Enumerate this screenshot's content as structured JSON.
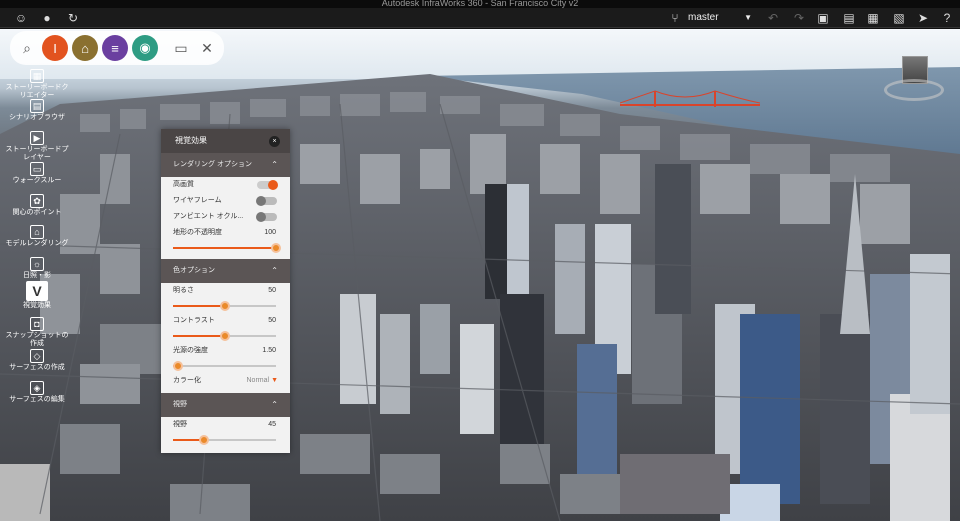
{
  "window": {
    "title": "Autodesk InfraWorks 360 - San Francisco City v2"
  },
  "topbar": {
    "branch": "master",
    "icons": [
      "user-icon",
      "record-icon",
      "sync-icon",
      "branch-icon",
      "undo-icon",
      "redo-icon",
      "bookmark-icon",
      "grid-icon",
      "image-icon",
      "select-cursor-icon",
      "help-icon"
    ]
  },
  "main_tools": [
    {
      "name": "build-tool",
      "color": "#e2531f",
      "glyph": "I"
    },
    {
      "name": "analyze-tool",
      "color": "#8a7030",
      "glyph": "⌂"
    },
    {
      "name": "bridge-tool",
      "color": "#6a3fa0",
      "glyph": "≡"
    },
    {
      "name": "share-tool",
      "color": "#2e9c83",
      "glyph": "◉"
    }
  ],
  "side_tools": [
    {
      "label": "ストーリーボードクリエイター"
    },
    {
      "label": "シナリオブラウザ"
    },
    {
      "label": "ストーリーボードプレイヤー"
    },
    {
      "label": "ウォークスルー"
    },
    {
      "label": "関心のポイント"
    },
    {
      "label": "モデルレンダリング"
    },
    {
      "label": "日照・影"
    },
    {
      "label": "視覚効果"
    },
    {
      "label": "スナップショットの作成"
    },
    {
      "label": "サーフェスの作成"
    },
    {
      "label": "サーフェスの編集"
    }
  ],
  "panel": {
    "title": "視覚効果",
    "close": "×",
    "sections": {
      "rendering": {
        "title": "レンダリング オプション",
        "high_quality": "高画質",
        "wireframe": "ワイヤフレーム",
        "ambient": "アンビエント オクル...",
        "terrain_opacity": "地形の不透明度",
        "terrain_opacity_value": "100"
      },
      "color": {
        "title": "色オプション",
        "brightness": "明るさ",
        "brightness_value": "50",
        "contrast": "コントラスト",
        "contrast_value": "50",
        "light_intensity": "光源の強度",
        "light_intensity_value": "1.50",
        "colorize": "カラー化",
        "colorize_value": "Normal"
      },
      "fov": {
        "title": "視野",
        "view": "視野",
        "view_value": "45"
      }
    },
    "levels": {
      "high_quality_on": true,
      "wireframe_on": false,
      "ambient_on": false,
      "terrain_opacity": 1.0,
      "brightness": 0.5,
      "contrast": 0.5,
      "light_intensity": 0.05,
      "fov": 0.3
    }
  }
}
